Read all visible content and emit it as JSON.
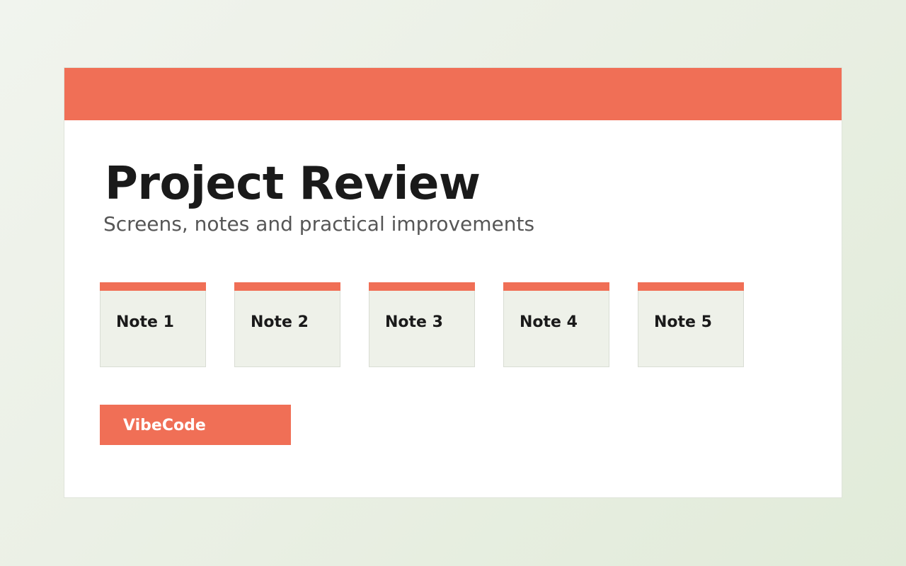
{
  "header": {
    "title": "Project Review",
    "subtitle": "Screens, notes and practical improvements"
  },
  "notes": [
    {
      "label": "Note 1"
    },
    {
      "label": "Note 2"
    },
    {
      "label": "Note 3"
    },
    {
      "label": "Note 4"
    },
    {
      "label": "Note 5"
    }
  ],
  "brand": {
    "label": "VibeCode"
  },
  "colors": {
    "accent": "#f06f56",
    "card_background": "#ffffff",
    "note_background": "#eef1e9",
    "title_text": "#1a1a1a",
    "subtitle_text": "#565656"
  }
}
